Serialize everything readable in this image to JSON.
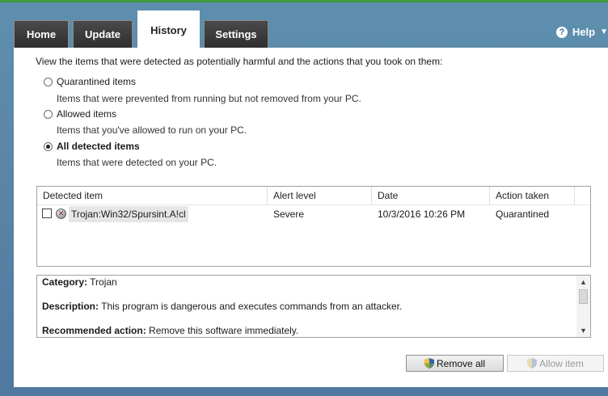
{
  "tabs": [
    {
      "label": "Home"
    },
    {
      "label": "Update"
    },
    {
      "label": "History"
    },
    {
      "label": "Settings"
    }
  ],
  "active_tab": "History",
  "help": {
    "label": "Help",
    "icon": "help-icon"
  },
  "intro": "View the items that were detected as potentially harmful and the actions that you took on them:",
  "options": [
    {
      "label": "Quarantined items",
      "desc": "Items that were prevented from running but not removed from your PC.",
      "checked": false
    },
    {
      "label": "Allowed items",
      "desc": "Items that you've allowed to run on your PC.",
      "checked": false
    },
    {
      "label": "All detected items",
      "desc": "Items that were detected on your PC.",
      "checked": true
    }
  ],
  "table": {
    "columns": [
      "Detected item",
      "Alert level",
      "Date",
      "Action taken"
    ],
    "rows": [
      {
        "name": "Trojan:Win32/Spursint.A!cl",
        "alert": "Severe",
        "date": "10/3/2016 10:26 PM",
        "action": "Quarantined"
      }
    ]
  },
  "details": {
    "category_label": "Category:",
    "category": "Trojan",
    "description_label": "Description:",
    "description": "This program is dangerous and executes commands from an attacker.",
    "recommended_label": "Recommended action:",
    "recommended": "Remove this software immediately."
  },
  "buttons": {
    "remove_all": "Remove all",
    "allow_item": "Allow item"
  }
}
